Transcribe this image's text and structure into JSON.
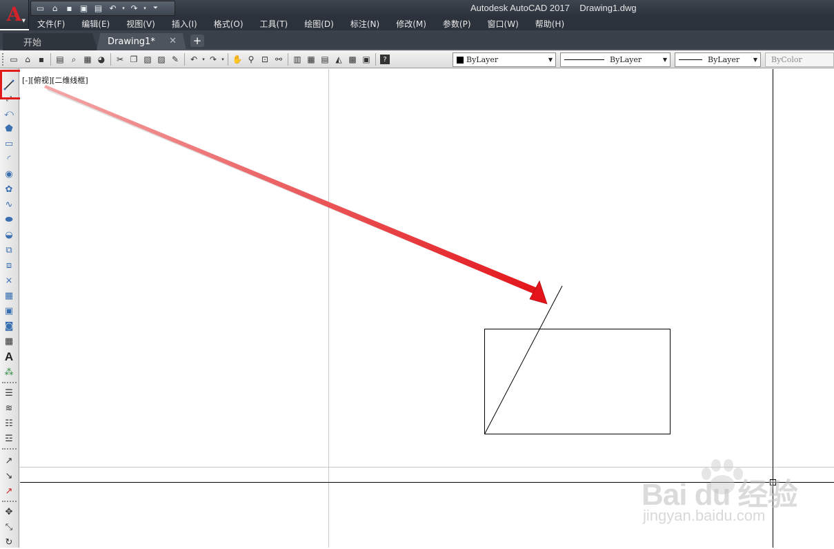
{
  "window": {
    "title": "Autodesk AutoCAD 2017    Drawing1.dwg",
    "app_logo": "A"
  },
  "quick_access": {
    "icons": [
      "new-icon",
      "open-icon",
      "save-icon",
      "save-as-icon",
      "print-icon",
      "undo-icon",
      "redo-icon",
      "customize-icon"
    ]
  },
  "menu": {
    "items": [
      "文件(F)",
      "编辑(E)",
      "视图(V)",
      "插入(I)",
      "格式(O)",
      "工具(T)",
      "绘图(D)",
      "标注(N)",
      "修改(M)",
      "参数(P)",
      "窗口(W)",
      "帮助(H)"
    ]
  },
  "tabs": {
    "start_label": "开始",
    "drawing_label": "Drawing1*",
    "close_glyph": "✕",
    "add_glyph": "+"
  },
  "toolbar": {
    "color_combo": "ByLayer",
    "linetype_combo": "ByLayer",
    "lineweight_combo": "ByLayer",
    "plotstyle_combo": "ByColor"
  },
  "viewport": {
    "label": "[-][俯视][二维线框]"
  },
  "draw_toolbar": {
    "highlighted_tool": "line-icon",
    "text_tool_glyph": "A"
  },
  "annotation": {
    "arrow_color": "#e3151a",
    "highlight_color": "#e21a1a"
  },
  "watermark": {
    "brand": "Bai du 经验",
    "url": "jingyan.baidu.com"
  }
}
